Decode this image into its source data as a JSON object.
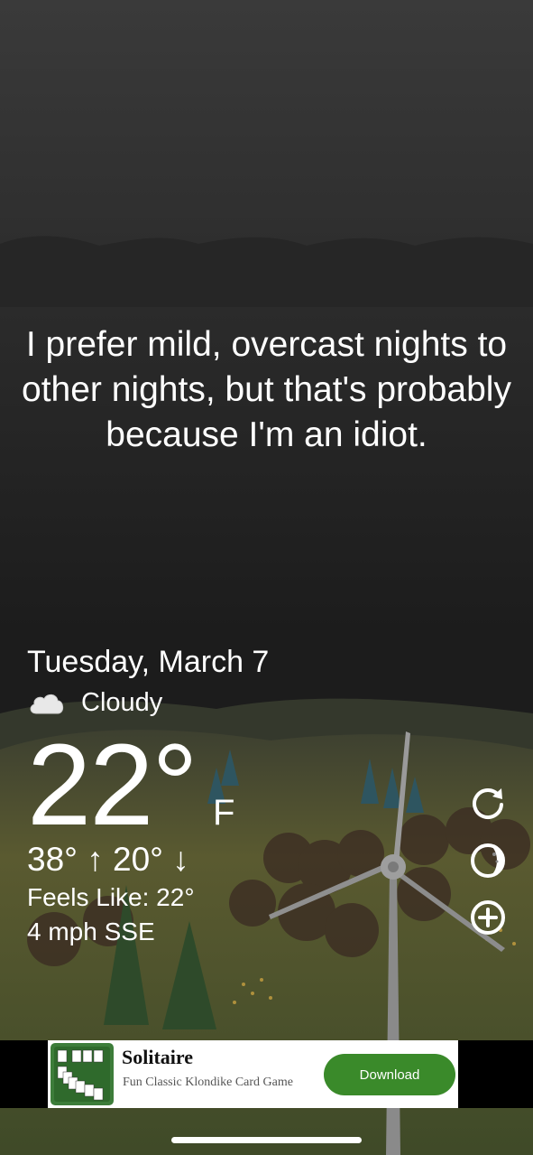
{
  "quote": "I prefer mild, overcast nights to other nights, but that's probably because I'm an idiot.",
  "weather": {
    "date": "Tuesday, March 7",
    "condition_icon": "cloud-icon",
    "condition": "Cloudy",
    "temperature": "22°",
    "unit": "F",
    "high": "38°",
    "high_arrow": "↑",
    "low": "20°",
    "low_arrow": "↓",
    "feels_like": "Feels Like: 22°",
    "wind": "4 mph SSE"
  },
  "controls": [
    {
      "icon": "refresh-icon"
    },
    {
      "icon": "moon-phase-icon"
    },
    {
      "icon": "add-icon"
    }
  ],
  "ad": {
    "title": "Solitaire",
    "subtitle": "Fun Classic Klondike Card Game",
    "button": "Download"
  },
  "colors": {
    "sky": "#202020",
    "hills": "#4a5430",
    "ad_button": "#3a8a2a"
  }
}
